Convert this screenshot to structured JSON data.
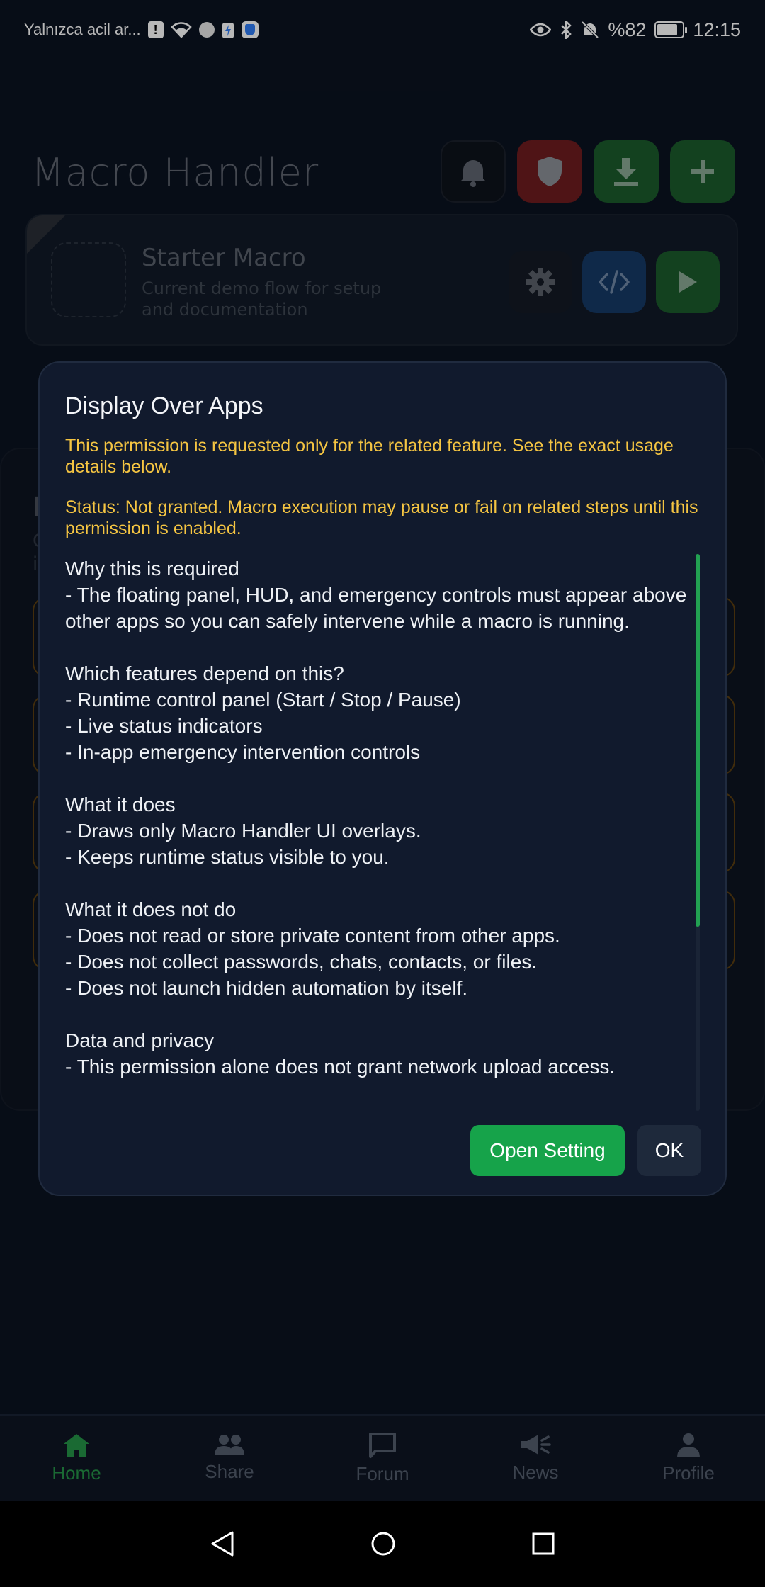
{
  "status_bar": {
    "carrier_text": "Yalnızca acil ar...",
    "battery_percent": "%82",
    "battery_level": 0.82,
    "time": "12:15",
    "left_icons": [
      "alert-icon",
      "wifi-icon",
      "android-icon",
      "charging-icon",
      "shield-app-icon"
    ],
    "right_icons": [
      "eye-icon",
      "bluetooth-icon",
      "mute-icon",
      "battery-icon"
    ]
  },
  "header": {
    "app_title": "Macro Handler",
    "buttons": [
      "bell-icon",
      "shield-icon",
      "download-icon",
      "plus-icon"
    ]
  },
  "macro_card": {
    "name": "Starter Macro",
    "description": "Current demo flow for setup and documentation"
  },
  "background_panel": {
    "letter": "P",
    "sub_lines": [
      "C",
      "it"
    ]
  },
  "dialog": {
    "title": "Display Over Apps",
    "notice": "This permission is requested only for the related feature. See the exact usage details below.",
    "status": "Status: Not granted. Macro execution may pause or fail on related steps until this permission is enabled.",
    "sections": [
      {
        "heading": "Why this is required",
        "lines": [
          "- The floating panel, HUD, and emergency controls must appear above other apps so you can safely intervene while a macro is running."
        ]
      },
      {
        "heading": "Which features depend on this?",
        "lines": [
          "- Runtime control panel (Start / Stop / Pause)",
          "- Live status indicators",
          "- In-app emergency intervention controls"
        ]
      },
      {
        "heading": "What it does",
        "lines": [
          "- Draws only Macro Handler UI overlays.",
          "- Keeps runtime status visible to you."
        ]
      },
      {
        "heading": "What it does not do",
        "lines": [
          "- Does not read or store private content from other apps.",
          "- Does not collect passwords, chats, contacts, or files.",
          "- Does not launch hidden automation by itself."
        ]
      },
      {
        "heading": "Data and privacy",
        "lines": [
          "- This permission alone does not grant network upload access."
        ]
      }
    ],
    "open_setting_label": "Open Setting",
    "ok_label": "OK"
  },
  "bottom_nav": {
    "items": [
      {
        "label": "Home",
        "icon": "home-icon",
        "active": true
      },
      {
        "label": "Share",
        "icon": "people-icon",
        "active": false
      },
      {
        "label": "Forum",
        "icon": "chat-icon",
        "active": false
      },
      {
        "label": "News",
        "icon": "megaphone-icon",
        "active": false
      },
      {
        "label": "Profile",
        "icon": "person-icon",
        "active": false
      }
    ]
  },
  "colors": {
    "accent_green": "#16a34a",
    "warning_yellow": "#f5c542",
    "danger_red": "#6e1c1f",
    "dialog_bg": "#111a2d"
  }
}
